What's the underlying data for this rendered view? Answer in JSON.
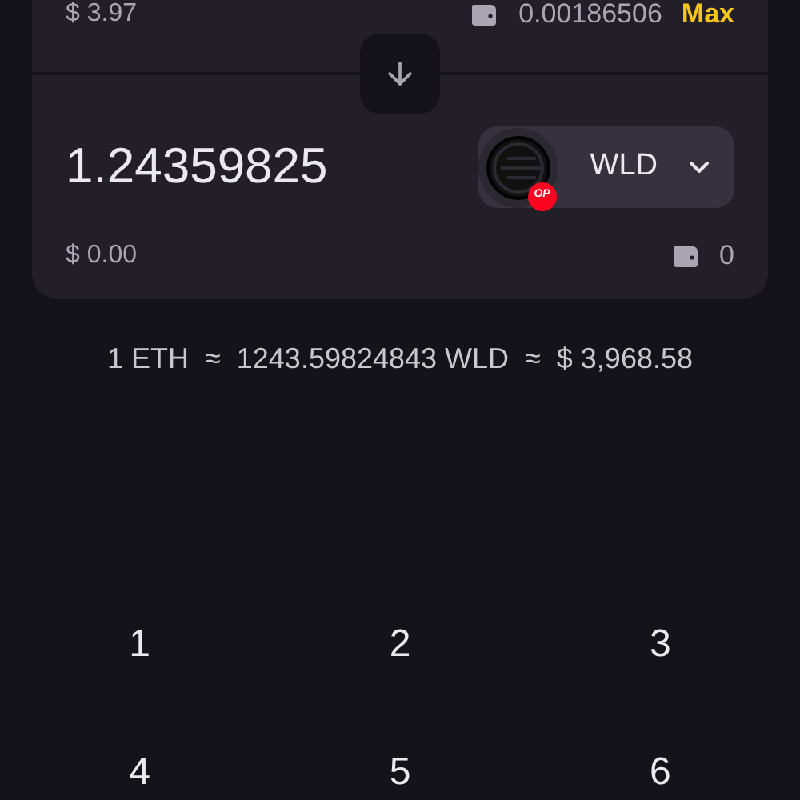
{
  "from": {
    "fiat_value": "$ 3.97",
    "balance": "0.00186506",
    "max_label": "Max"
  },
  "to": {
    "amount": "1.24359825",
    "token": {
      "symbol": "WLD",
      "network_badge": "OP"
    },
    "fiat_value": "$ 0.00",
    "balance": "0"
  },
  "rate": "1 ETH  ≈  1243.59824843 WLD  ≈  $ 3,968.58",
  "keypad": [
    [
      "1",
      "2",
      "3"
    ],
    [
      "4",
      "5",
      "6"
    ]
  ]
}
